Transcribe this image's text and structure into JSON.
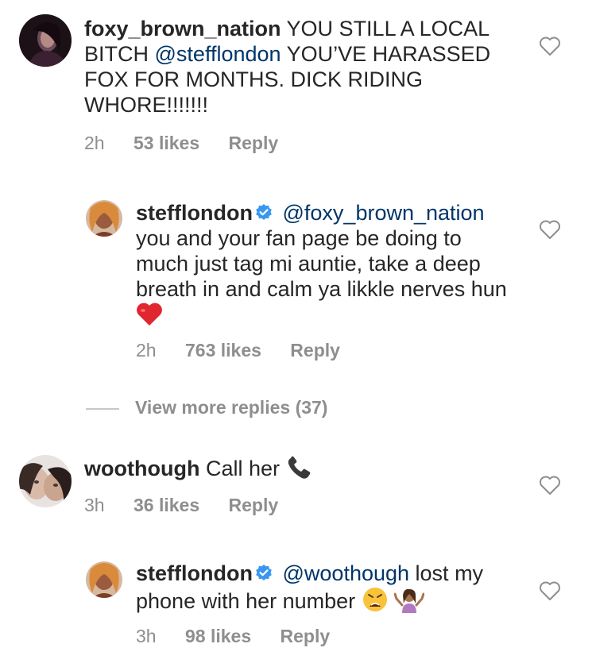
{
  "comments": [
    {
      "username": "foxy_brown_nation",
      "text": "YOU STILL A LOCAL BITCH",
      "mention": "@stefflondon",
      "text2": "YOU’VE HARASSED FOX FOR MONTHS. DICK RIDING WHORE!!!!!!!",
      "time": "2h",
      "likes": "53 likes",
      "reply": "Reply"
    },
    {
      "username": "stefflondon",
      "mention": "@foxy_brown_nation",
      "text": "you and your fan page be doing to much just tag mi auntie, take a deep breath in and calm ya likkle nerves hun",
      "emoji": "red-heart-emoji",
      "time": "2h",
      "likes": "763 likes",
      "reply": "Reply"
    },
    {
      "username": "woothough",
      "text": "Call her",
      "emoji": "telephone-receiver-emoji",
      "time": "3h",
      "likes": "36 likes",
      "reply": "Reply"
    },
    {
      "username": "stefflondon",
      "mention": "@woothough",
      "text": "lost my phone with her number",
      "emoji": "weary-face-and-shrugging-emoji",
      "time": "3h",
      "likes": "98 likes",
      "reply": "Reply"
    }
  ],
  "view_more_replies": "View more replies (37)"
}
